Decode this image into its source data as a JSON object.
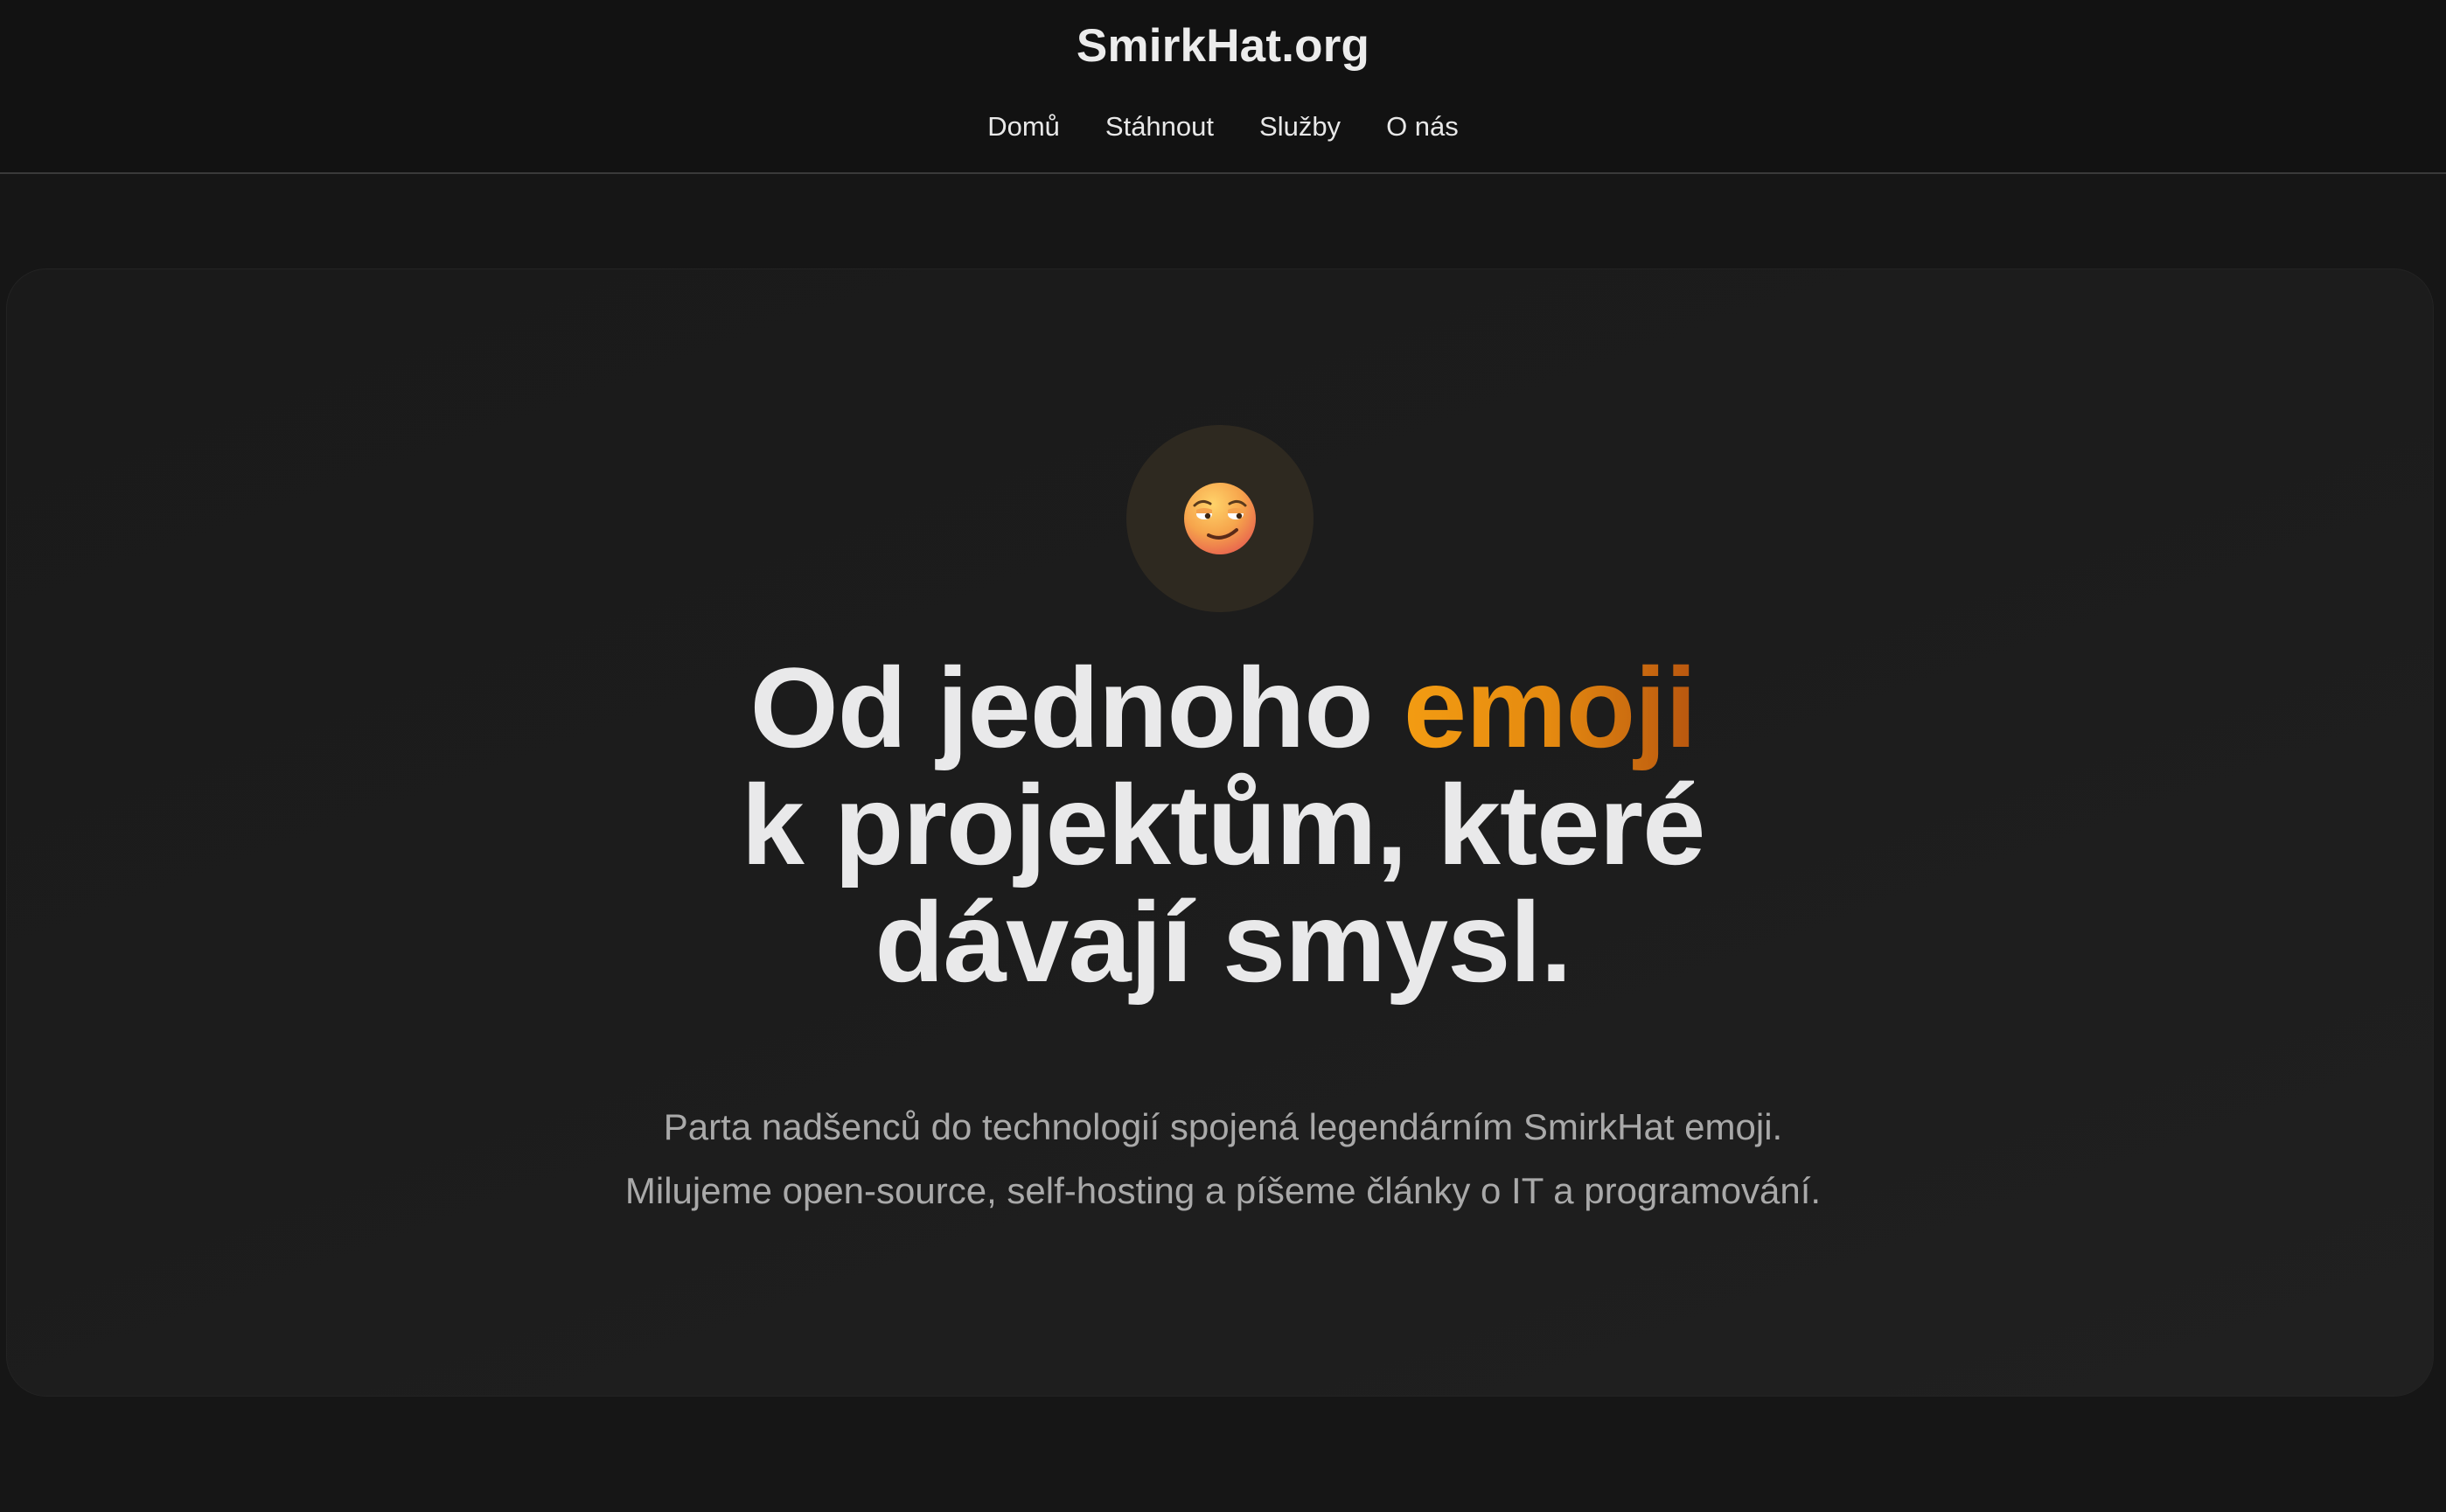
{
  "header": {
    "brand": "SmirkHat.org",
    "nav": [
      {
        "label": "Domů"
      },
      {
        "label": "Stáhnout"
      },
      {
        "label": "Služby"
      },
      {
        "label": "O nás"
      }
    ]
  },
  "hero": {
    "icon": "smirk-emoji-icon",
    "headline": {
      "line1_prefix": "Od jednoho ",
      "line1_accent": "emoji",
      "line2": "k projektům, které",
      "line3": "dávají smysl."
    },
    "subtitle": {
      "line1": "Parta nadšenců do technologií spojená legendárním SmirkHat emoji.",
      "line2": "Milujeme open-source, self-hosting a píšeme články o IT a programování."
    }
  },
  "colors": {
    "background": "#161616",
    "header": "#121212",
    "card": "#1c1c1c",
    "accent_start": "#f39c12",
    "accent_end": "#b8560f",
    "text": "#e9e9ea",
    "muted": "#a9a9a9"
  }
}
